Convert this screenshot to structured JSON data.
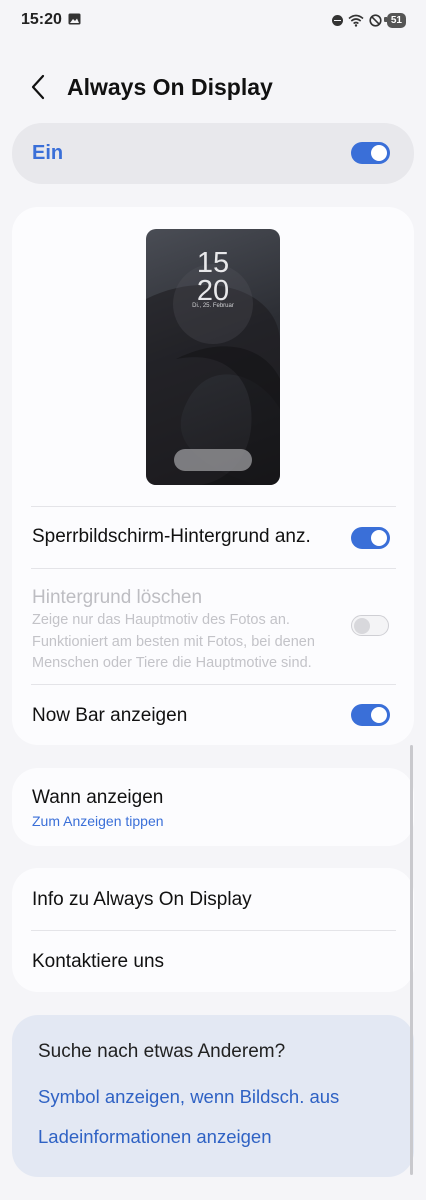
{
  "status_bar": {
    "time": "15:20",
    "battery": "51",
    "icons": [
      "image-icon",
      "dnd-icon",
      "wifi-icon",
      "blocked-icon",
      "battery-icon"
    ]
  },
  "header": {
    "title": "Always On Display",
    "back_icon": "chevron-left-icon"
  },
  "master_switch": {
    "label": "Ein",
    "on": true
  },
  "preview": {
    "hour": "15",
    "minute": "20",
    "date": "Di., 25. Februar"
  },
  "settings": [
    {
      "label": "Sperrbildschirm-Hintergrund anz.",
      "on": true,
      "enabled": true
    },
    {
      "label": "Hintergrund löschen",
      "description": "Zeige nur das Hauptmotiv des Fotos an. Funktioniert am besten mit Fotos, bei denen Menschen oder Tiere die Hauptmotive sind.",
      "on": false,
      "enabled": false
    },
    {
      "label": "Now Bar anzeigen",
      "on": true,
      "enabled": true
    }
  ],
  "when": {
    "label": "Wann anzeigen",
    "sub": "Zum Anzeigen tippen"
  },
  "info": {
    "about": "Info zu Always On Display",
    "contact": "Kontaktiere uns"
  },
  "search": {
    "title": "Suche nach etwas Anderem?",
    "links": [
      "Symbol anzeigen, wenn Bildsch. aus",
      "Ladeinformationen anzeigen"
    ]
  },
  "colors": {
    "accent": "#3a6fd8",
    "background": "#f5f5f8",
    "card": "#fcfcfe",
    "suggest_card": "#e3e8f3"
  }
}
